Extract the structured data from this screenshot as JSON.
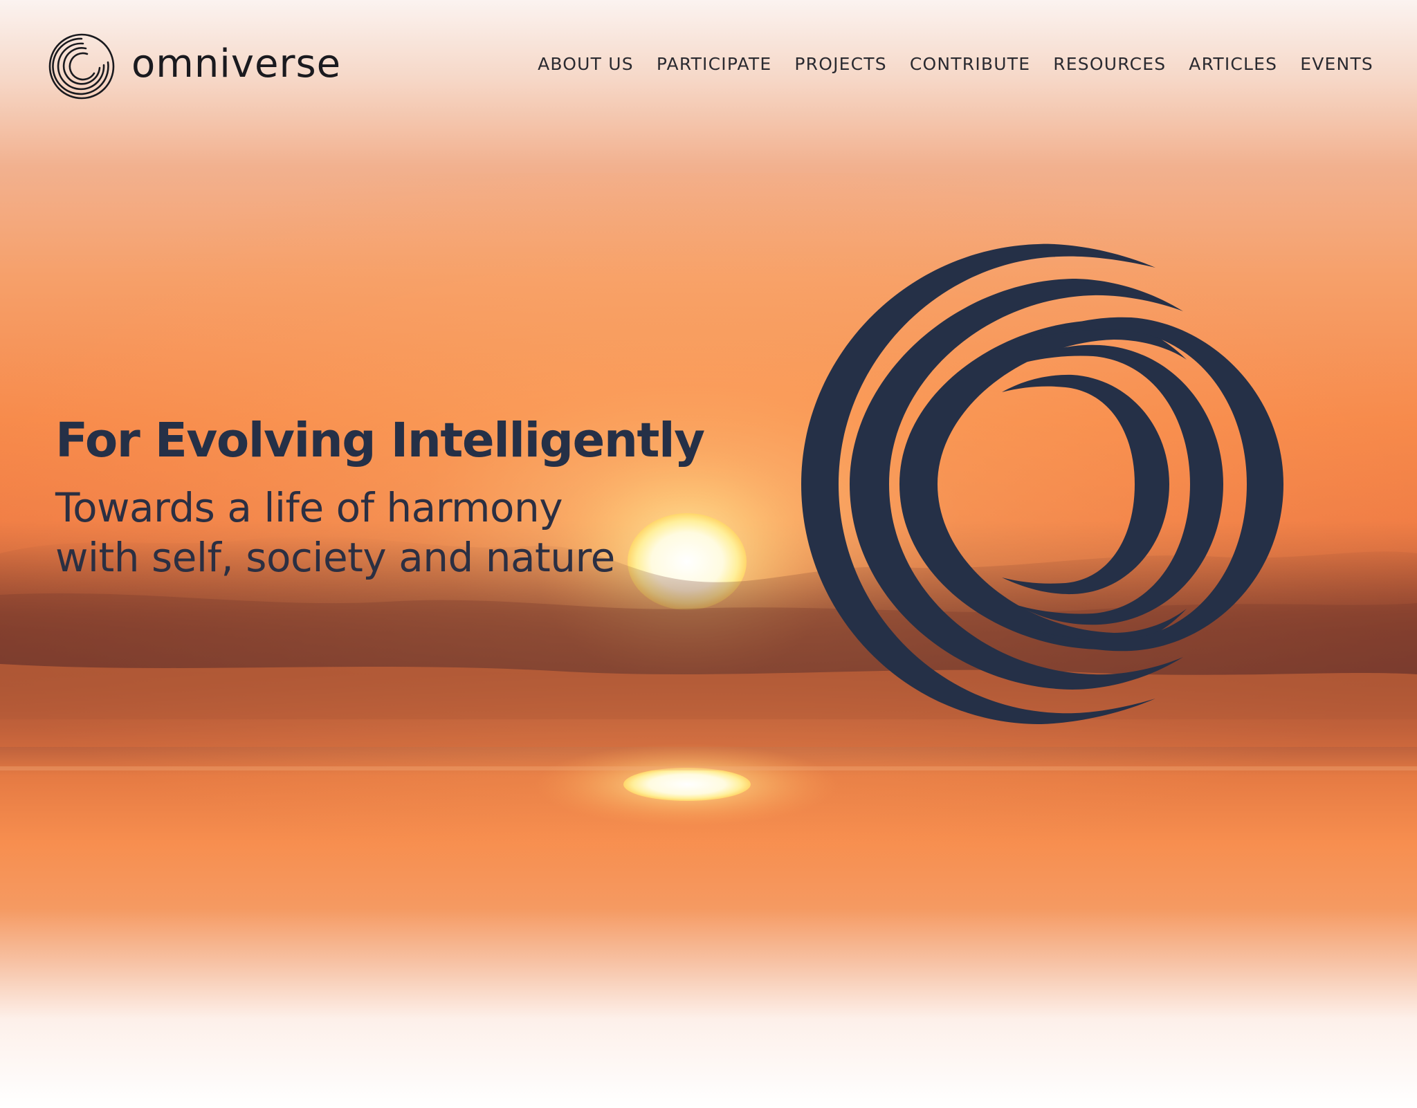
{
  "brand": {
    "name": "omniverse",
    "icon": "omniverse-spiral-logo-icon",
    "ink_color": "#1a1a1f"
  },
  "nav": {
    "items": [
      {
        "label": "ABOUT US"
      },
      {
        "label": "PARTICIPATE"
      },
      {
        "label": "PROJECTS"
      },
      {
        "label": "CONTRIBUTE"
      },
      {
        "label": "RESOURCES"
      },
      {
        "label": "ARTICLES"
      },
      {
        "label": "EVENTS"
      }
    ]
  },
  "hero": {
    "title": "For Evolving Intelligently",
    "subtitle_line1": "Towards a life of harmony",
    "subtitle_line2": "with self, society and nature",
    "emblem_icon": "omniverse-spiral-emblem-icon",
    "background": "sunset-over-sea-image",
    "colors": {
      "navy": "#253047",
      "sky_orange": "#f5884a",
      "sun": "#fff7c8"
    }
  }
}
